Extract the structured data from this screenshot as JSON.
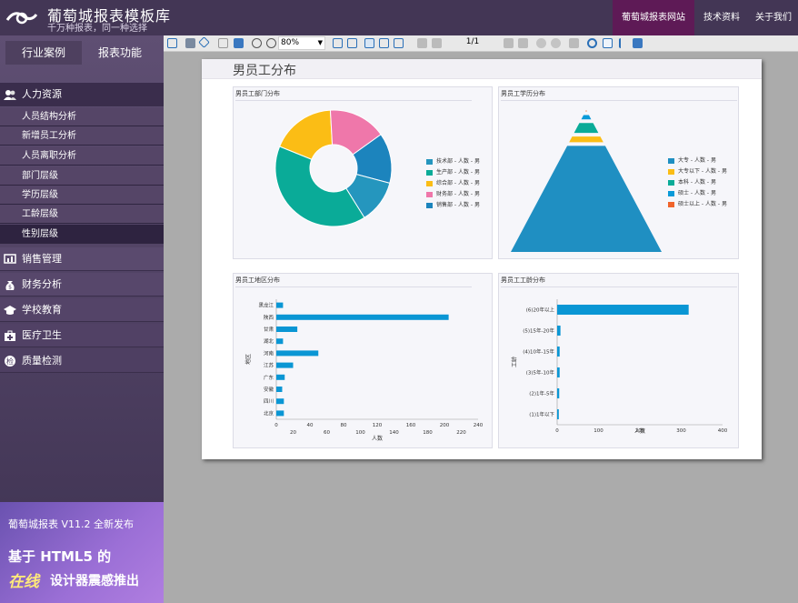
{
  "header": {
    "title": "葡萄城报表模板库",
    "subtitle": "千万种报表，同一种选择",
    "nav": [
      "葡萄城报表网站",
      "技术资料",
      "关于我们"
    ]
  },
  "sidebar": {
    "tabs": [
      "行业案例",
      "报表功能"
    ],
    "groups": [
      {
        "label": "人力资源",
        "icon": "people-icon",
        "expanded": true,
        "items": [
          "人员结构分析",
          "新增员工分析",
          "人员离职分析",
          "部门层级",
          "学历层级",
          "工龄层级",
          "性别层级"
        ]
      },
      {
        "label": "销售管理",
        "icon": "sales-icon"
      },
      {
        "label": "财务分析",
        "icon": "money-bag-icon"
      },
      {
        "label": "学校教育",
        "icon": "graduation-cap-icon"
      },
      {
        "label": "医疗卫生",
        "icon": "medical-kit-icon"
      },
      {
        "label": "质量检测",
        "icon": "quality-check-icon"
      }
    ],
    "selected_item": "性别层级"
  },
  "promo": {
    "line1": "葡萄城报表 V11.2 全新发布",
    "line2": "基于 HTML5 的",
    "line3_emph": "在线",
    "line3": "设计器震感推出"
  },
  "toolbar": {
    "zoom": "80%",
    "page": "1/1"
  },
  "report": {
    "title": "男员工分布"
  },
  "chart_data": [
    {
      "type": "pie",
      "title": "男员工部门分布",
      "donut": true,
      "legend_position": "right",
      "series": [
        {
          "name": "技术部 - 人数 - 男",
          "value": 12,
          "color": "#2596be"
        },
        {
          "name": "生产部 - 人数 - 男",
          "value": 40,
          "color": "#0aab98"
        },
        {
          "name": "综合部 - 人数 - 男",
          "value": 18,
          "color": "#fbbd15"
        },
        {
          "name": "财务部 - 人数 - 男",
          "value": 16,
          "color": "#ef77aa"
        },
        {
          "name": "销售部 - 人数 - 男",
          "value": 14,
          "color": "#1c84bd"
        }
      ],
      "slice_order": [
        "销售部 - 人数 - 男",
        "技术部 - 人数 - 男",
        "生产部 - 人数 - 男",
        "综合部 - 人数 - 男",
        "财务部 - 人数 - 男"
      ]
    },
    {
      "type": "pyramid",
      "title": "男员工学历分布",
      "legend_position": "right",
      "series": [
        {
          "name": "大专 - 人数 - 男",
          "value": 150,
          "color": "#1f8fc2"
        },
        {
          "name": "大专以下 - 人数 - 男",
          "value": 8,
          "color": "#fbbd15"
        },
        {
          "name": "本科 - 人数 - 男",
          "value": 14,
          "color": "#0aab98"
        },
        {
          "name": "硕士 - 人数 - 男",
          "value": 6,
          "color": "#0a9ad8"
        },
        {
          "name": "硕士以上 - 人数 - 男",
          "value": 2,
          "color": "#f0642b"
        }
      ],
      "stack_order_top_to_bottom": [
        "硕士以上 - 人数 - 男",
        "硕士 - 人数 - 男",
        "本科 - 人数 - 男",
        "大专以下 - 人数 - 男",
        "大专 - 人数 - 男"
      ]
    },
    {
      "type": "bar",
      "orientation": "horizontal",
      "title": "男员工地区分布",
      "xlabel": "人数",
      "ylabel": "地区",
      "xlim": [
        0,
        240
      ],
      "x_ticks_top": [
        0,
        40,
        80,
        120,
        160,
        200,
        240
      ],
      "x_ticks_bottom": [
        20,
        60,
        100,
        140,
        180,
        220
      ],
      "color": "#0a96d4",
      "categories": [
        "黑龙江",
        "陕西",
        "甘肃",
        "湖北",
        "河南",
        "江苏",
        "广东",
        "安徽",
        "四川",
        "北京"
      ],
      "values": [
        8,
        205,
        25,
        8,
        50,
        20,
        10,
        7,
        9,
        9
      ]
    },
    {
      "type": "bar",
      "orientation": "horizontal",
      "title": "男员工工龄分布",
      "xlabel": "人数",
      "ylabel": "工龄",
      "xlim": [
        0,
        400
      ],
      "x_ticks": [
        0,
        100,
        200,
        300,
        400
      ],
      "color": "#0a96d4",
      "categories": [
        "(6)20年以上",
        "(5)15年-20年",
        "(4)10年-15年",
        "(3)5年-10年",
        "(2)1年-5年",
        "(1)1年以下"
      ],
      "values": [
        318,
        8,
        6,
        6,
        5,
        4
      ]
    }
  ]
}
